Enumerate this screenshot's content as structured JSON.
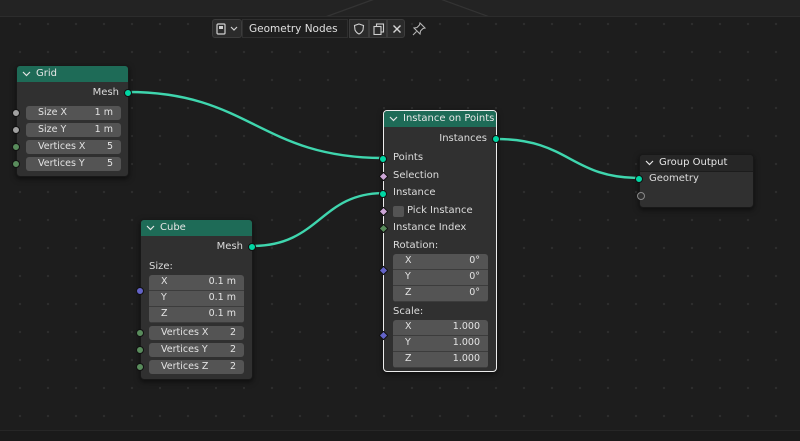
{
  "header": {
    "tree_name": "Geometry Nodes"
  },
  "nodes": {
    "grid": {
      "title": "Grid",
      "output": "Mesh",
      "fields": [
        {
          "label": "Size X",
          "value": "1 m"
        },
        {
          "label": "Size Y",
          "value": "1 m"
        },
        {
          "label": "Vertices X",
          "value": "5"
        },
        {
          "label": "Vertices Y",
          "value": "5"
        }
      ]
    },
    "cube": {
      "title": "Cube",
      "output": "Mesh",
      "size_label": "Size:",
      "size": [
        {
          "label": "X",
          "value": "0.1 m"
        },
        {
          "label": "Y",
          "value": "0.1 m"
        },
        {
          "label": "Z",
          "value": "0.1 m"
        }
      ],
      "fields": [
        {
          "label": "Vertices X",
          "value": "2"
        },
        {
          "label": "Vertices Y",
          "value": "2"
        },
        {
          "label": "Vertices Z",
          "value": "2"
        }
      ]
    },
    "instance_on_points": {
      "title": "Instance on Points",
      "output": "Instances",
      "inputs": {
        "points": "Points",
        "selection": "Selection",
        "instance": "Instance",
        "pick_instance": "Pick Instance",
        "instance_index": "Instance Index"
      },
      "rotation_label": "Rotation:",
      "rotation": [
        {
          "label": "X",
          "value": "0°"
        },
        {
          "label": "Y",
          "value": "0°"
        },
        {
          "label": "Z",
          "value": "0°"
        }
      ],
      "scale_label": "Scale:",
      "scale": [
        {
          "label": "X",
          "value": "1.000"
        },
        {
          "label": "Y",
          "value": "1.000"
        },
        {
          "label": "Z",
          "value": "1.000"
        }
      ]
    },
    "group_output": {
      "title": "Group Output",
      "input": "Geometry"
    }
  },
  "colors": {
    "geometry_socket": "#00d6a3",
    "geometry_header": "#1e6b57",
    "link": "#3fd6ae",
    "canvas": "#1d1d1d"
  }
}
